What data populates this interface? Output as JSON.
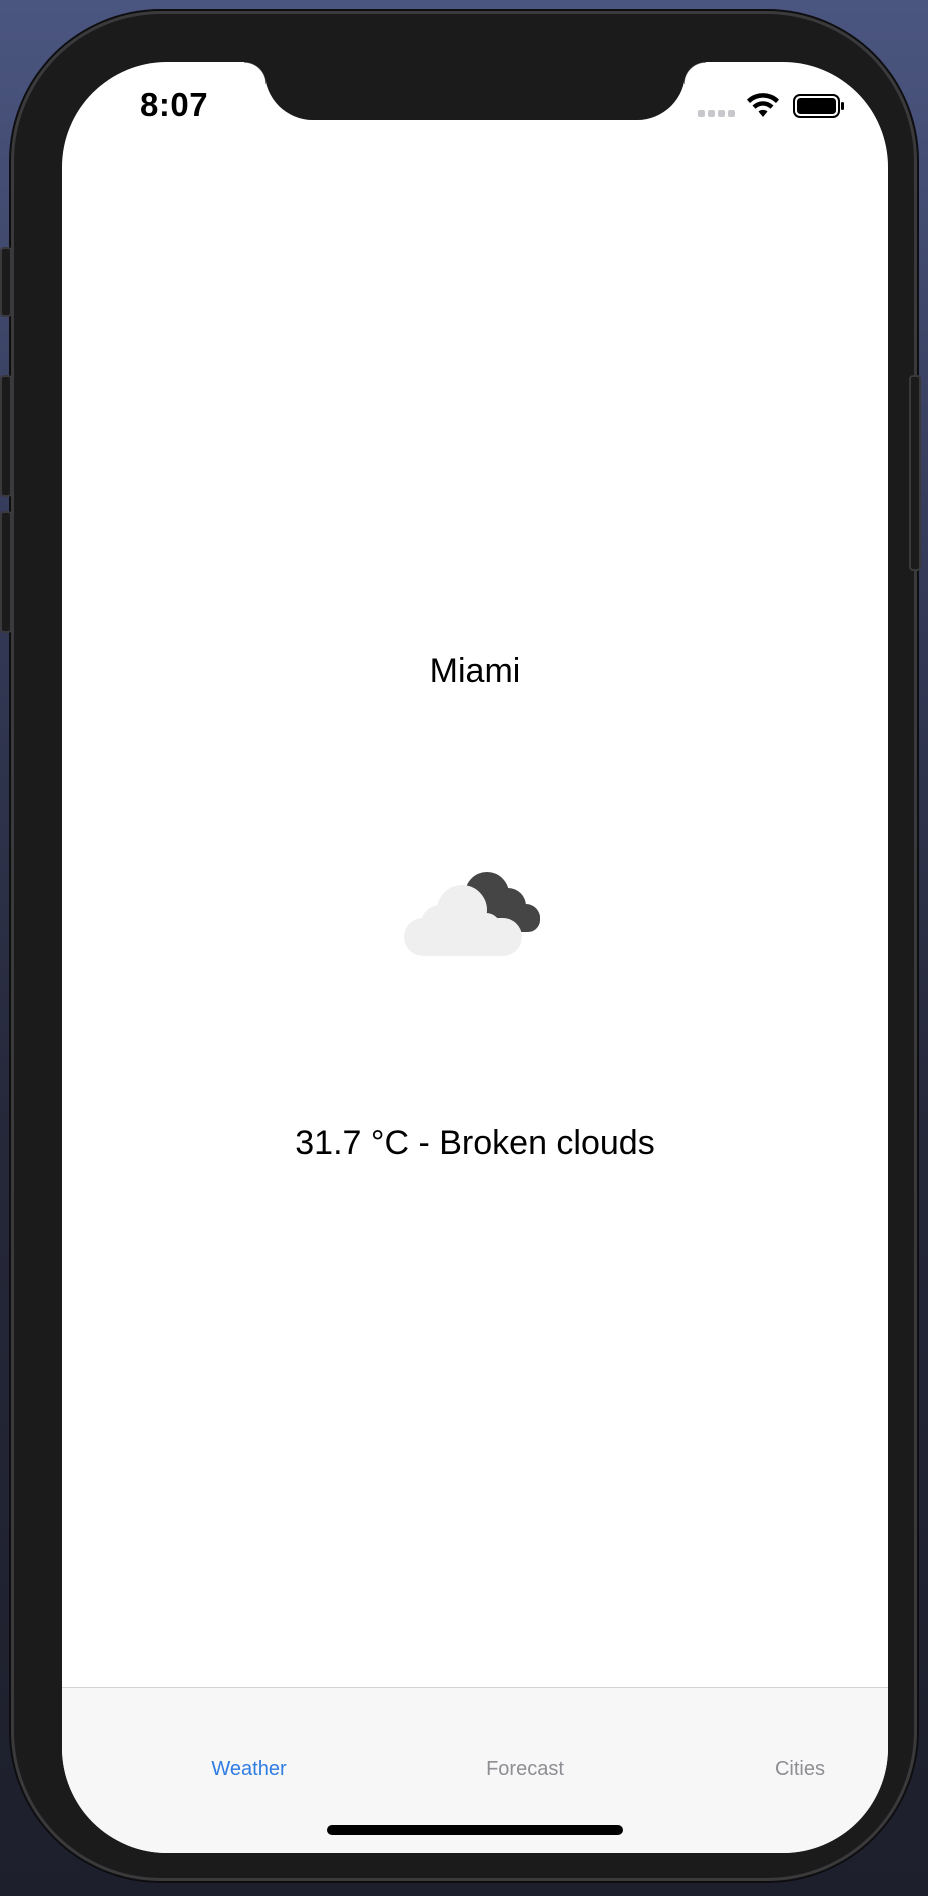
{
  "status_bar": {
    "time": "8:07",
    "icons": [
      "cellular-dots-icon",
      "wifi-icon",
      "battery-icon"
    ]
  },
  "weather": {
    "city": "Miami",
    "condition_icon": "broken-clouds-icon",
    "summary": "31.7 °C - Broken clouds"
  },
  "tabbar": {
    "tabs": [
      {
        "label": "Weather",
        "active": true
      },
      {
        "label": "Forecast",
        "active": false
      },
      {
        "label": "Cities",
        "active": false
      }
    ]
  },
  "colors": {
    "accent": "#2f7de1",
    "inactive_tab": "#8e8e93",
    "cloud_light": "#efefef",
    "cloud_dark": "#454545"
  }
}
